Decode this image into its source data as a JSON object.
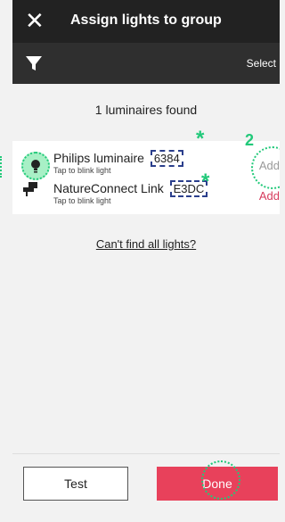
{
  "header": {
    "title": "Assign lights to group"
  },
  "toolbar": {
    "select_label": "Select"
  },
  "summary": {
    "found_text": "1 luminaires found"
  },
  "list": {
    "items": [
      {
        "name": "Philips luminaire",
        "code": "6384",
        "subtitle": "Tap to blink light",
        "action": "Add"
      },
      {
        "name": "NatureConnect Link",
        "code": "E3DC",
        "subtitle": "Tap to blink light",
        "action": "Add"
      }
    ]
  },
  "help": {
    "link_text": "Can't find all lights?"
  },
  "footer": {
    "test_label": "Test",
    "done_label": "Done"
  },
  "annotations": {
    "step_number": "2",
    "asterisk": "*"
  },
  "colors": {
    "accent": "#e8415b",
    "annotation_green": "#22c97a",
    "code_border": "#2b3f8c"
  }
}
